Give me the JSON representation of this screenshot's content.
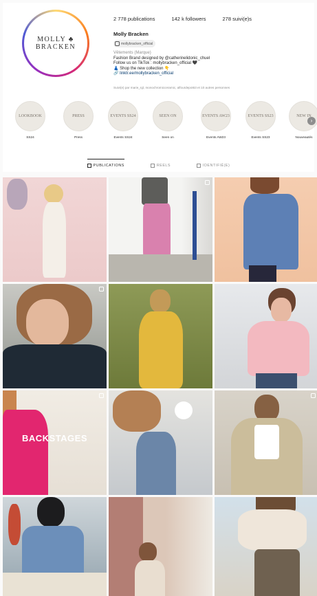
{
  "profile": {
    "logo_line1": "MOLLY ♣",
    "logo_line2": "BRACKEN",
    "stats": {
      "posts": "2 778 publications",
      "followers": "142 k followers",
      "following": "278 suivi(e)s"
    },
    "name": "Molly Bracken",
    "handle_tag": "mollybracken_official",
    "bio": [
      {
        "text": "Vêtements (Marque)",
        "style": "muted"
      },
      {
        "text": "Fashion Brand designed by @catherinelidonic_chuel",
        "style": "normal"
      },
      {
        "text": "Follow us on TikTok : mollybracken_official 🖤",
        "style": "normal"
      },
      {
        "text": "👗 Shop the new collection 👇",
        "style": "normal"
      },
      {
        "text": "🔗 linktr.ee/mollybracken_official",
        "style": "link"
      }
    ],
    "followed_by": "Suivi(e) par marie_rgl, monochromicceramic, alfourdepot63 et 10 autres personnes"
  },
  "highlights": [
    {
      "circle": "LOOKBOOK",
      "label": "SS24"
    },
    {
      "circle": "PRESS",
      "label": "Press"
    },
    {
      "circle": "EVENTS SS24",
      "label": "Events SS24"
    },
    {
      "circle": "SEEN ON",
      "label": "Seen on"
    },
    {
      "circle": "EVENTS AW23",
      "label": "Events AW23"
    },
    {
      "circle": "EVENTS SS23",
      "label": "Events SS23"
    },
    {
      "circle": "NEW IN",
      "label": "Nouveautés"
    }
  ],
  "tabs": [
    {
      "label": "PUBLICATIONS",
      "active": true
    },
    {
      "label": "REELS",
      "active": false
    },
    {
      "label": "IDENTIFIÉ(E)",
      "active": false
    }
  ],
  "posts": [
    {
      "overlay": "",
      "multi": false
    },
    {
      "overlay": "",
      "multi": true
    },
    {
      "overlay": "",
      "multi": false
    },
    {
      "overlay": "",
      "multi": true
    },
    {
      "overlay": "",
      "multi": false
    },
    {
      "overlay": "",
      "multi": false
    },
    {
      "overlay": "BACKSTAGES",
      "multi": true
    },
    {
      "overlay": "",
      "multi": false
    },
    {
      "overlay": "",
      "multi": true
    },
    {
      "overlay": "",
      "multi": false
    },
    {
      "overlay": "",
      "multi": false
    },
    {
      "overlay": "",
      "multi": false
    }
  ]
}
